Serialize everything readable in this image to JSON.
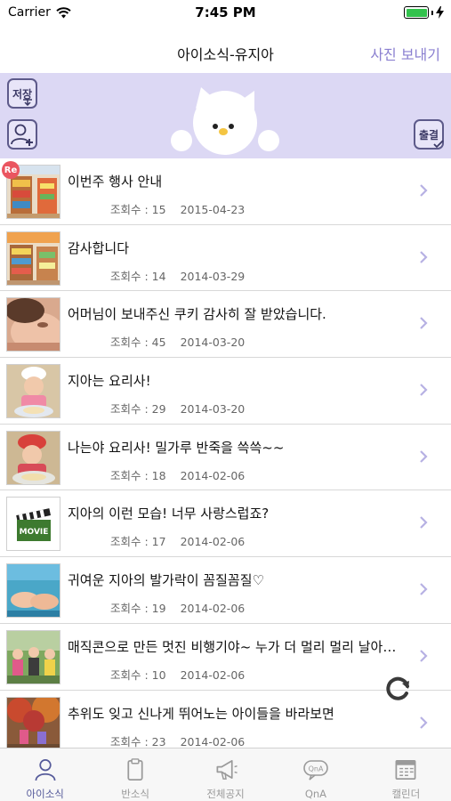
{
  "status_bar": {
    "carrier": "Carrier",
    "time": "7:45 PM",
    "battery_level": 1.0,
    "battery_color": "#33c24d",
    "wifi_icon": "wifi-icon",
    "charging_icon": "lightning-icon"
  },
  "nav": {
    "title": "아이소식-유지아",
    "action_label": "사진 보내기"
  },
  "banner": {
    "background": "#dcd8f4",
    "save_label": "저장",
    "attend_label": "출결",
    "addchild_icon": "add-person-icon",
    "mascot_icon": "white-cat-mascot"
  },
  "posts": [
    {
      "title": "이번주 행사 안내",
      "views_label": "조회수 : 15",
      "date": "2015-04-23",
      "badge": "Re",
      "thumb": "classroom-shelves-photo"
    },
    {
      "title": "감사합니다",
      "views_label": "조회수 : 14",
      "date": "2014-03-29",
      "thumb": "classroom-shelves-photo"
    },
    {
      "title": "어머님이 보내주신 쿠키 감사히 잘 받았습니다.",
      "views_label": "조회수 : 45",
      "date": "2014-03-20",
      "thumb": "child-closeup-photo"
    },
    {
      "title": "지아는 요리사!",
      "views_label": "조회수 : 29",
      "date": "2014-03-20",
      "thumb": "child-cooking-photo"
    },
    {
      "title": "나는야 요리사! 밀가루 반죽을 쓱쓱~~",
      "views_label": "조회수 : 18",
      "date": "2014-02-06",
      "thumb": "child-cooking-photo"
    },
    {
      "title": "지아의 이런 모습! 너무 사랑스럽죠?",
      "views_label": "조회수 : 17",
      "date": "2014-02-06",
      "thumb": "movie-clapper-icon",
      "thumb_text": "MOVIE"
    },
    {
      "title": "귀여운 지아의 발가락이 꼼질꼼질♡",
      "views_label": "조회수 : 19",
      "date": "2014-02-06",
      "thumb": "baby-feet-photo"
    },
    {
      "title": "매직콘으로 만든 멋진 비행기야~ 누가 더 멀리 멀리 날아…",
      "views_label": "조회수 : 10",
      "date": "2014-02-06",
      "thumb": "children-outdoors-photo"
    },
    {
      "title": "추위도 잊고 신나게 뛰어노는 아이들을 바라보면",
      "views_label": "조회수 : 23",
      "date": "2014-02-06",
      "thumb": "children-autumn-photo"
    }
  ],
  "refresh_icon": "refresh-icon",
  "tabs": [
    {
      "label": "아이소식",
      "icon": "person-icon",
      "active": true
    },
    {
      "label": "반소식",
      "icon": "clipboard-icon",
      "active": false
    },
    {
      "label": "전체공지",
      "icon": "megaphone-icon",
      "active": false
    },
    {
      "label": "QnA",
      "icon": "qna-bubble-icon",
      "icon_text": "QnA",
      "active": false
    },
    {
      "label": "캘린더",
      "icon": "calendar-icon",
      "active": false
    }
  ],
  "colors": {
    "accent": "#8a7fd0",
    "tab_active": "#555a9a",
    "badge": "#ea5560"
  }
}
